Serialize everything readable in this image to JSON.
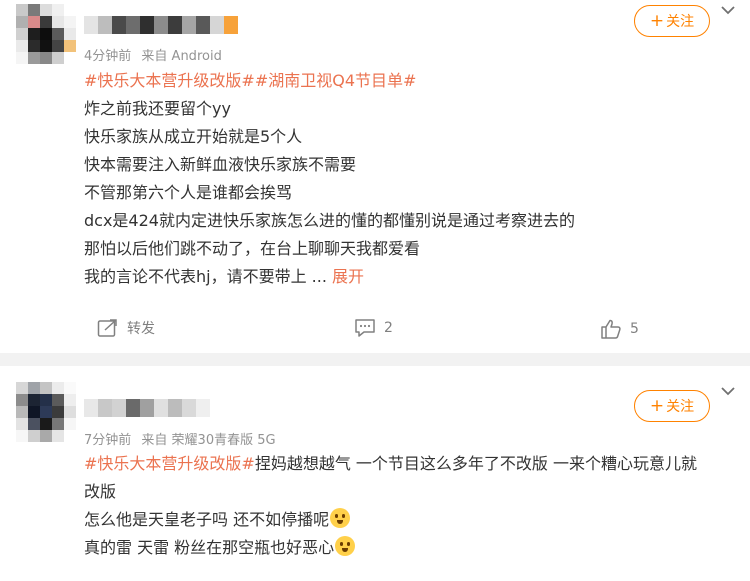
{
  "comments": [
    {
      "meta": {
        "time": "4分钟前",
        "source": "来自 Android",
        "device": ""
      },
      "follow_label": "关注",
      "follow_plus": "+",
      "lines": [
        {
          "tags": [
            "#快乐大本营升级改版#",
            "#湖南卫视Q4节目单#"
          ]
        },
        {
          "text": "炸之前我还要留个yy"
        },
        {
          "text": "快乐家族从成立开始就是5个人"
        },
        {
          "text": "快本需要注入新鲜血液快乐家族不需要"
        },
        {
          "text": "不管那第六个人是谁都会挨骂"
        },
        {
          "text": "dcx是424就内定进快乐家族怎么进的懂的都懂别说是通过考察进去的"
        },
        {
          "text": "那怕以后他们跳不动了，在台上聊聊天我都爱看"
        },
        {
          "text": "我的言论不代表hj，请不要带上"
        }
      ],
      "expand_prefix": " ... ",
      "expand_label": "展开",
      "actions": {
        "forward_label": "转发",
        "comment_count": "2",
        "like_count": "5"
      }
    },
    {
      "meta": {
        "time": "7分钟前",
        "source": "来自 荣耀30青春版 5G"
      },
      "follow_label": "关注",
      "follow_plus": "+",
      "line1_tag": "#快乐大本营升级改版#",
      "line1_text": "捏妈越想越气 一个节目这么多年了不改版 一来个糟心玩意儿就",
      "line2_text": "改版",
      "line3_text": "怎么他是天皇老子吗 还不如停播呢",
      "line4_text": "真的雷 天雷 粉丝在那空瓶也好恶心"
    }
  ],
  "colors": {
    "accent": "#ff8200",
    "link": "#eb7350",
    "meta": "#939393",
    "text": "#333333"
  },
  "icons": [
    "forward-icon",
    "comment-icon",
    "like-icon",
    "chevron-down-icon",
    "emoji-icon"
  ]
}
